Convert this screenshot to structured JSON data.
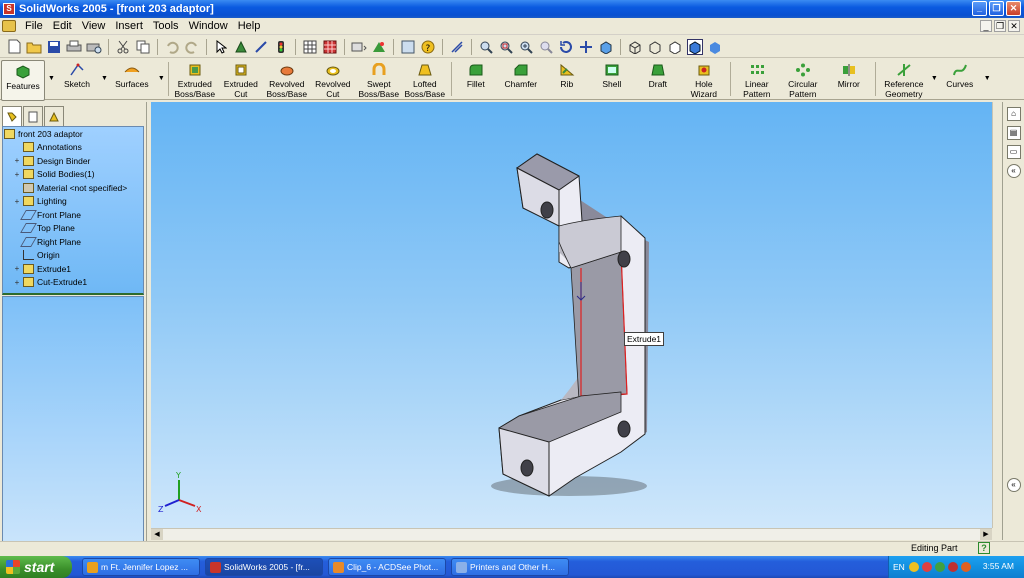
{
  "window": {
    "title": "SolidWorks 2005 - [front 203 adaptor]",
    "controls": [
      "_",
      "❐",
      "✕"
    ]
  },
  "menubar": {
    "items": [
      "File",
      "Edit",
      "View",
      "Insert",
      "Tools",
      "Window",
      "Help"
    ],
    "doc_controls": [
      "_",
      "❐",
      "✕"
    ]
  },
  "command_manager": {
    "tabs": [
      {
        "label": "Features",
        "icon": "features-icon"
      },
      {
        "label": "Sketch",
        "icon": "sketch-icon"
      },
      {
        "label": "Surfaces",
        "icon": "surfaces-icon"
      }
    ],
    "commands": [
      {
        "label": "Extruded\nBoss/Base",
        "icon": "extruded-boss-icon"
      },
      {
        "label": "Extruded\nCut",
        "icon": "extruded-cut-icon"
      },
      {
        "label": "Revolved\nBoss/Base",
        "icon": "revolved-boss-icon"
      },
      {
        "label": "Revolved\nCut",
        "icon": "revolved-cut-icon"
      },
      {
        "label": "Swept\nBoss/Base",
        "icon": "swept-boss-icon"
      },
      {
        "label": "Lofted\nBoss/Base",
        "icon": "lofted-boss-icon"
      },
      {
        "label": "Fillet",
        "icon": "fillet-icon"
      },
      {
        "label": "Chamfer",
        "icon": "chamfer-icon"
      },
      {
        "label": "Rib",
        "icon": "rib-icon"
      },
      {
        "label": "Shell",
        "icon": "shell-icon"
      },
      {
        "label": "Draft",
        "icon": "draft-icon"
      },
      {
        "label": "Hole\nWizard",
        "icon": "hole-wizard-icon"
      },
      {
        "label": "Linear\nPattern",
        "icon": "linear-pattern-icon"
      },
      {
        "label": "Circular\nPattern",
        "icon": "circular-pattern-icon"
      },
      {
        "label": "Mirror",
        "icon": "mirror-icon"
      },
      {
        "label": "Reference\nGeometry",
        "icon": "reference-geometry-icon"
      },
      {
        "label": "Curves",
        "icon": "curves-icon"
      }
    ]
  },
  "feature_tree": {
    "root": "front 203 adaptor",
    "items": [
      {
        "label": "Annotations",
        "expandable": false
      },
      {
        "label": "Design Binder",
        "expandable": true
      },
      {
        "label": "Solid Bodies(1)",
        "expandable": true
      },
      {
        "label": "Material <not specified>",
        "expandable": false
      },
      {
        "label": "Lighting",
        "expandable": true
      },
      {
        "label": "Front Plane",
        "expandable": false
      },
      {
        "label": "Top Plane",
        "expandable": false
      },
      {
        "label": "Right Plane",
        "expandable": false
      },
      {
        "label": "Origin",
        "expandable": false
      },
      {
        "label": "Extrude1",
        "expandable": true
      },
      {
        "label": "Cut-Extrude1",
        "expandable": true
      }
    ]
  },
  "viewport": {
    "tooltip": "Extrude1",
    "triad": {
      "x": "X",
      "y": "Y",
      "z": "Z"
    }
  },
  "status": {
    "mode": "Editing Part",
    "help": "?"
  },
  "taskbar": {
    "start": "start",
    "tasks": [
      {
        "label": "m Ft. Jennifer Lopez ...",
        "color": "#e8a020"
      },
      {
        "label": "SolidWorks 2005 - [fr...",
        "color": "#c8352a",
        "active": true
      },
      {
        "label": "Clip_6 - ACDSee Phot...",
        "color": "#e88a2a"
      },
      {
        "label": "Printers and Other H...",
        "color": "#8ab0e8"
      }
    ],
    "tray": {
      "lang": "EN",
      "time": "3:55 AM"
    }
  },
  "colors": {
    "accent": "#0a5ae0",
    "viewport_top": "#64b4f4",
    "viewport_bottom": "#cfe7fb",
    "selection_edge": "#e02020"
  }
}
